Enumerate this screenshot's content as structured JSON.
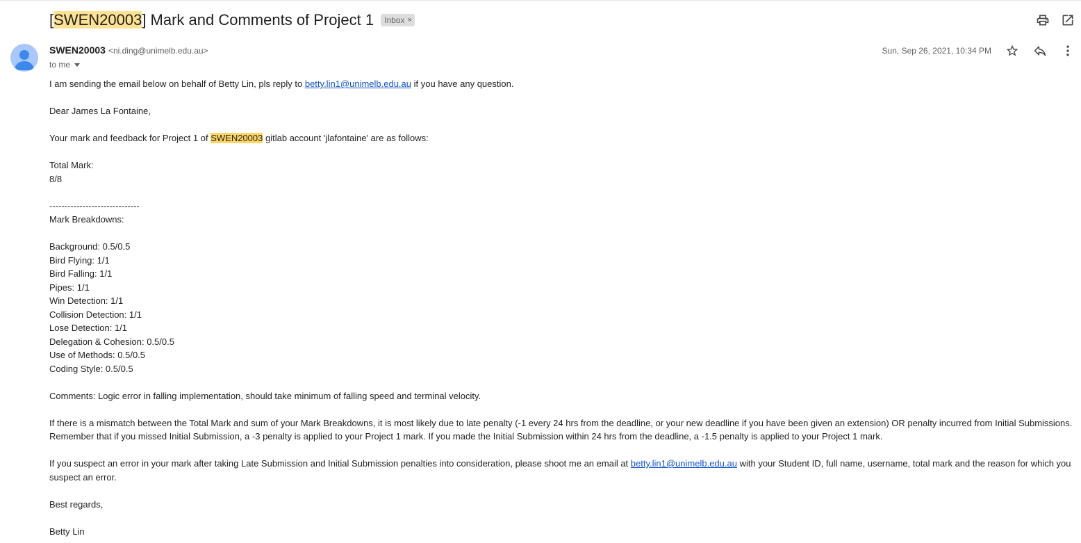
{
  "subject": {
    "prefix": "[",
    "tag": "SWEN20003",
    "rest": "] Mark and Comments of Project 1",
    "label": "Inbox",
    "label_remove": "×"
  },
  "header_icons": [
    "print-icon",
    "open-in-new-window-icon",
    "star-icon",
    "reply-icon",
    "more-vert-icon"
  ],
  "sender": {
    "name": "SWEN20003",
    "email": "<ni.ding@unimelb.edu.au>",
    "recipients": "to me",
    "date": "Sun, Sep 26, 2021, 10:34 PM"
  },
  "body": {
    "intro_pre": "I am sending the email below on behalf of Betty Lin, pls reply to",
    "intro_link": "betty.lin1@unimelb.edu.au",
    "intro_post": "if you have any question.",
    "greeting": "Dear James La Fontaine,",
    "feedback_pre": "Your mark and feedback for Project 1 of",
    "feedback_tag": "SWEN20003",
    "feedback_post": "gitlab account 'jlafontaine' are as follows:",
    "total_label": "Total Mark:",
    "total_value": "8/8",
    "divider": "------------------------------",
    "breakdown_title": "Mark Breakdowns:",
    "breakdowns": [
      "Background: 0.5/0.5",
      "Bird Flying: 1/1",
      "Bird Falling: 1/1",
      "Pipes: 1/1",
      "Win Detection: 1/1",
      "Collision Detection: 1/1",
      "Lose Detection: 1/1",
      "Delegation & Cohesion: 0.5/0.5",
      "Use of Methods: 0.5/0.5",
      "Coding Style: 0.5/0.5"
    ],
    "comments": "Comments: Logic error in falling implementation, should take minimum of falling speed and terminal velocity.",
    "mismatch_line1": "If there is a mismatch between the Total Mark and sum of your Mark Breakdowns, it is most likely due to late penalty (-1 every 24 hrs from the deadline, or your new deadline if you have been given an extension) OR penalty incurred from Initial Submissions.",
    "mismatch_line2": "Remember that if you missed Initial Submission, a -3 penalty is applied to your Project 1 mark. If you made the Initial Submission within 24 hrs from the deadline, a -1.5 penalty is applied to your Project 1 mark.",
    "suspect_pre": "If you suspect an error in your mark after taking Late Submission and Initial Submission penalties into consideration, please shoot me an email at",
    "suspect_link": "betty.lin1@unimelb.edu.au",
    "suspect_post": "with your Student ID, full name, username, total mark and the reason for which you suspect an error.",
    "closing": "Best regards,",
    "signature": "Betty Lin"
  }
}
